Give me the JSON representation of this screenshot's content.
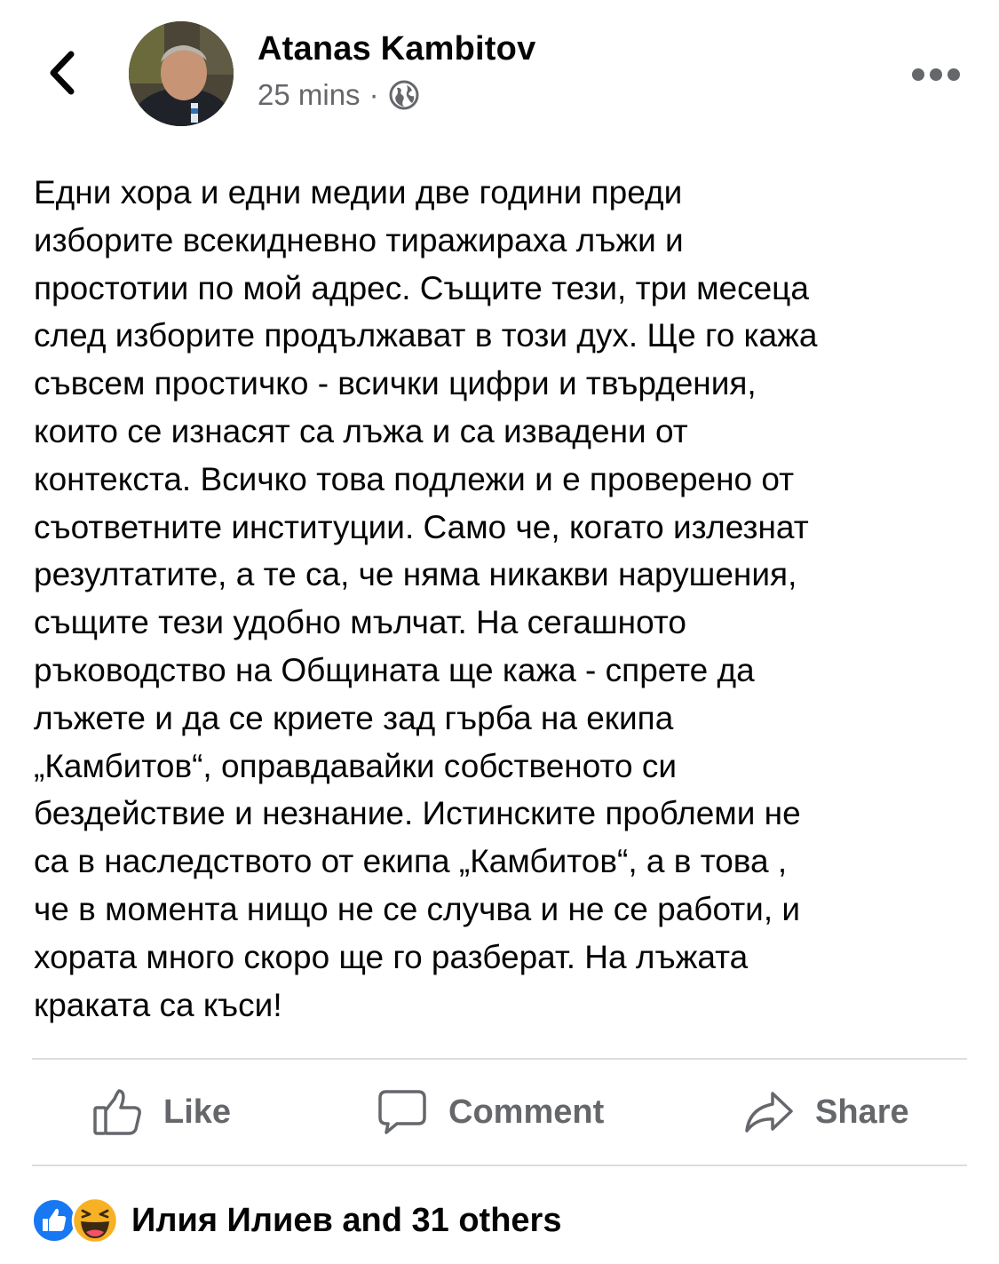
{
  "header": {
    "back_icon": "chevron-left-icon",
    "author_name": "Atanas Kambitov",
    "timestamp": "25 mins",
    "separator": "·",
    "audience_icon": "globe-icon",
    "more_icon": "more-horizontal-icon"
  },
  "post": {
    "text": "Едни хора и едни медии две години преди\nизборите всекидневно тиражираха лъжи и\nпростотии по мой адрес. Същите тези, три месеца\nслед изборите продължават в този дух. Ще го кажа\nсъвсем простичко - всички цифри и твърдения,\nкоито се изнасят са лъжа и са извадени от\nконтекста. Всичко това подлежи и е проверено от\nсъответните институции. Само че, когато излезнат\nрезултатите, а те са, че няма никакви нарушения,\nсъщите тези удобно мълчат. На сегашното\nръководство на Общината ще кажа - спрете да\nлъжете и да се криете зад гърба на екипа\n„Камбитов“, оправдавайки собственото си\nбездействие и незнание. Истинските проблеми не\nса в наследството от екипа „Камбитов“, а в това ,\nче в момента нищо не се случва и не се работи, и\nхората много скоро ще го разберат. На лъжата\nкраката са къси!"
  },
  "actions": {
    "like_label": "Like",
    "comment_label": "Comment",
    "share_label": "Share"
  },
  "reactions": {
    "icons": [
      "like-reaction-icon",
      "haha-reaction-icon"
    ],
    "summary": "Илия Илиев and 31 others"
  },
  "colors": {
    "text_primary": "#050505",
    "text_secondary": "#65676b",
    "divider": "#dadde1",
    "like_blue": "#1877f2",
    "haha_yellow": "#f7b125"
  }
}
